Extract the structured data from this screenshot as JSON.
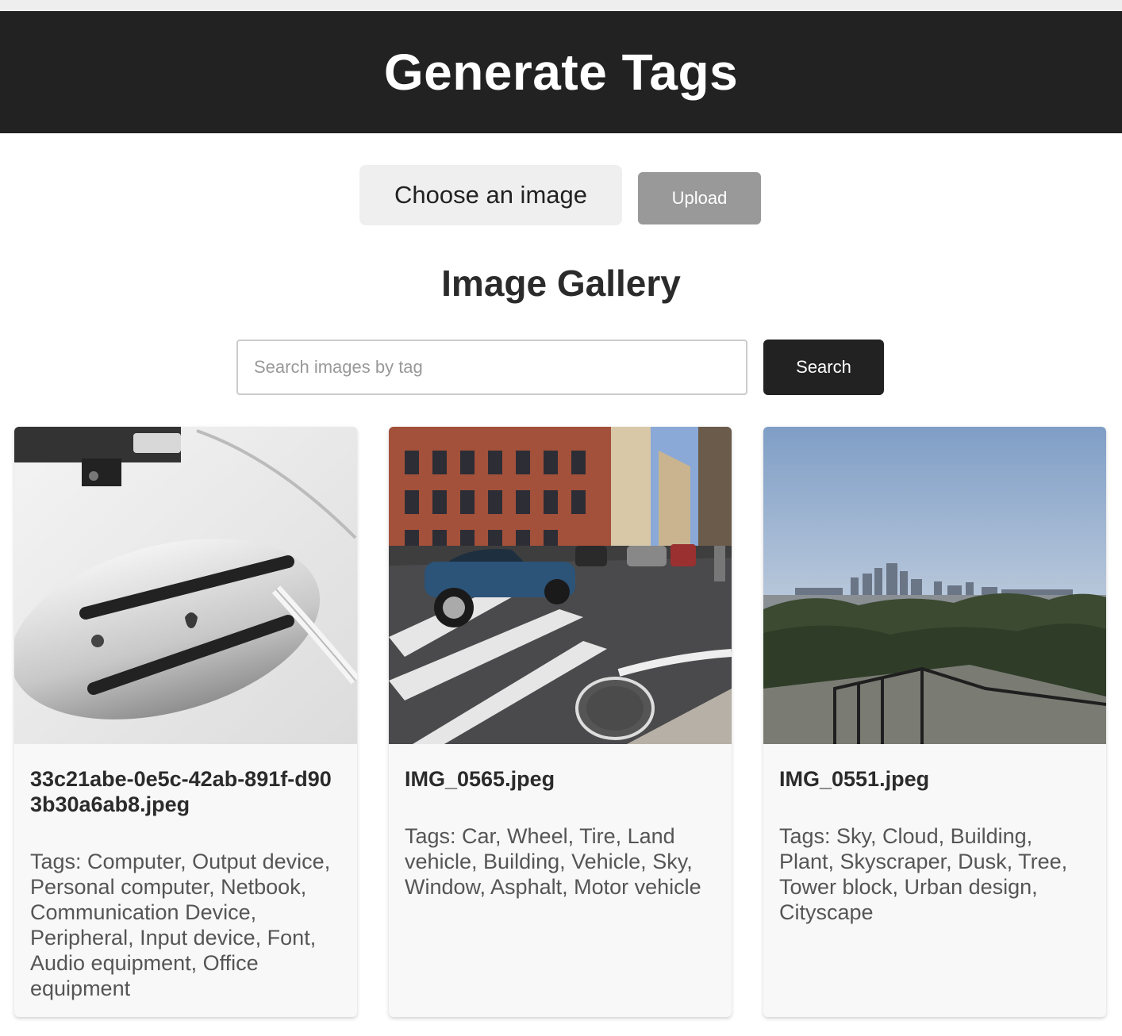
{
  "header": {
    "title": "Generate Tags"
  },
  "upload": {
    "choose_label": "Choose an image",
    "upload_label": "Upload"
  },
  "gallery": {
    "title": "Image Gallery",
    "search_placeholder": "Search images by tag",
    "search_label": "Search",
    "images": [
      {
        "filename": "33c21abe-0e5c-42ab-891f-d903b30a6ab8.jpeg",
        "tags": "Tags: Computer, Output device, Personal computer, Netbook, Communication Device, Peripheral, Input device, Font, Audio equipment, Office equipment"
      },
      {
        "filename": "IMG_0565.jpeg",
        "tags": "Tags: Car, Wheel, Tire, Land vehicle, Building, Vehicle, Sky, Window, Asphalt, Motor vehicle"
      },
      {
        "filename": "IMG_0551.jpeg",
        "tags": "Tags: Sky, Cloud, Building, Plant, Skyscraper, Dusk, Tree, Tower block, Urban design, Cityscape"
      }
    ]
  }
}
